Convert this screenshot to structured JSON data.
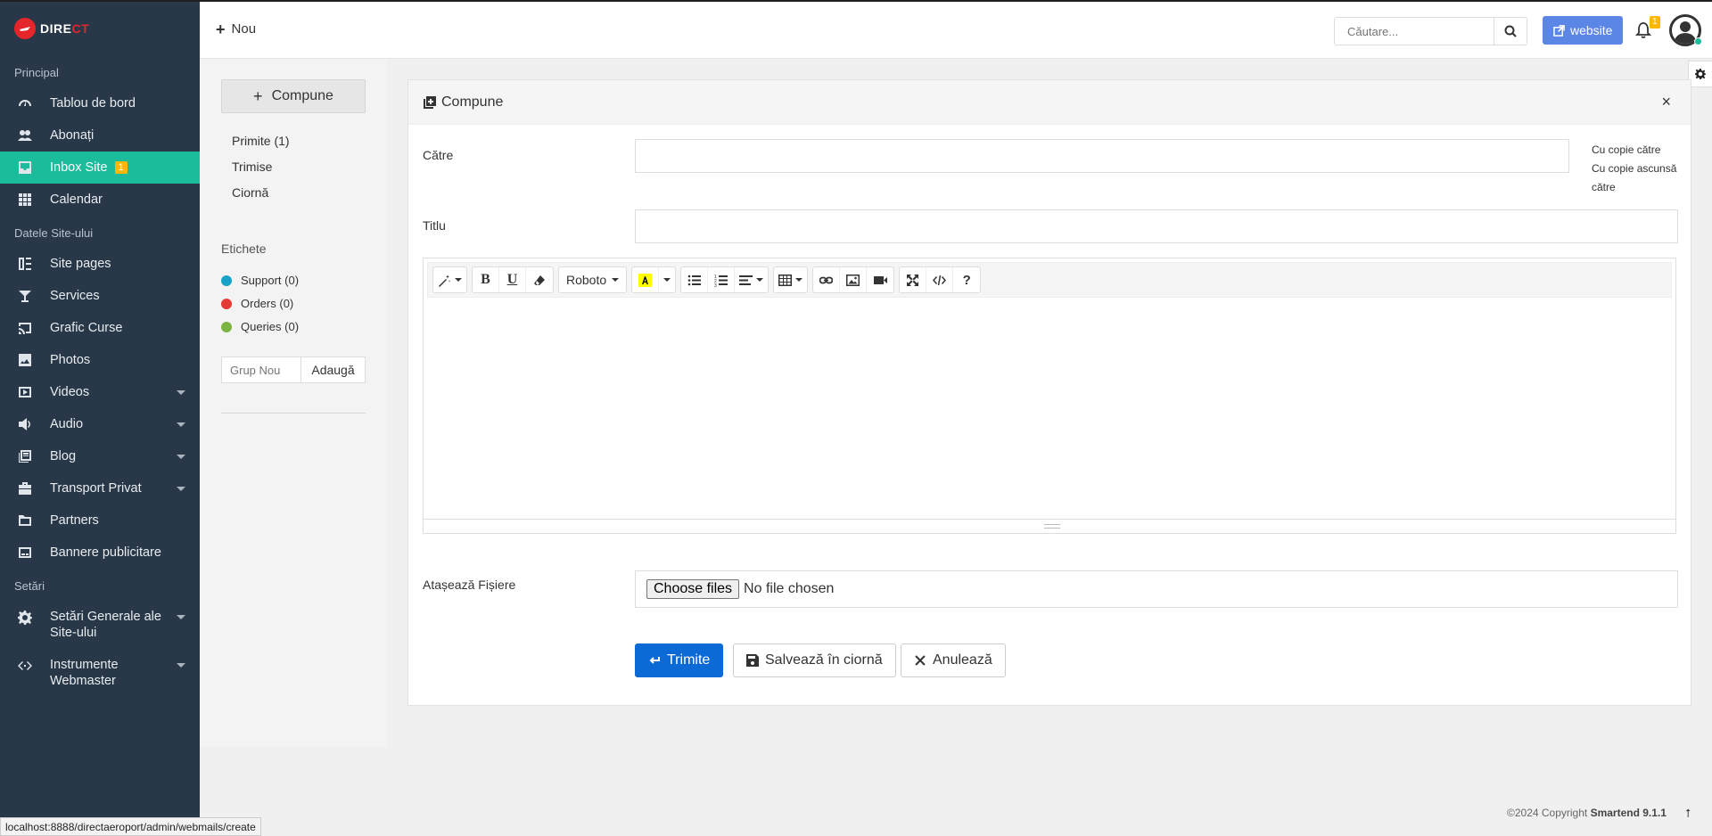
{
  "brand": {
    "logo_text_white": "DIRE",
    "logo_text_red": "CT"
  },
  "sidebar": {
    "sections": {
      "main": "Principal",
      "site_data": "Datele Site-ului",
      "settings": "Setări"
    },
    "items": [
      {
        "label": "Tablou de bord",
        "icon": "dashboard-icon"
      },
      {
        "label": "Abonați",
        "icon": "users-icon"
      },
      {
        "label": "Inbox Site",
        "icon": "inbox-icon",
        "badge": "1",
        "active": true
      },
      {
        "label": "Calendar",
        "icon": "calendar-grid-icon"
      },
      {
        "label": "Site pages",
        "icon": "pages-icon"
      },
      {
        "label": "Services",
        "icon": "services-icon"
      },
      {
        "label": "Grafic Curse",
        "icon": "cast-icon"
      },
      {
        "label": "Photos",
        "icon": "photo-icon"
      },
      {
        "label": "Videos",
        "icon": "video-icon",
        "caret": true
      },
      {
        "label": "Audio",
        "icon": "audio-icon",
        "caret": true
      },
      {
        "label": "Blog",
        "icon": "blog-icon",
        "caret": true
      },
      {
        "label": "Transport Privat",
        "icon": "transport-icon",
        "caret": true
      },
      {
        "label": "Partners",
        "icon": "folder-icon"
      },
      {
        "label": "Bannere publicitare",
        "icon": "banner-icon"
      },
      {
        "label": "Setări Generale ale Site-ului",
        "icon": "gear-icon",
        "caret": true
      },
      {
        "label": "Instrumente Webmaster",
        "icon": "code-icon",
        "caret": true
      }
    ]
  },
  "header": {
    "new_label": "Nou",
    "search_placeholder": "Căutare...",
    "website_label": "website",
    "notifications_badge": "1"
  },
  "mail": {
    "compose_label": "Compune",
    "folders": [
      "Primite (1)",
      "Trimise",
      "Ciornă"
    ],
    "labels_title": "Etichete",
    "labels": [
      {
        "name": "Support",
        "count": "(0)",
        "color": "#17a2c8"
      },
      {
        "name": "Orders",
        "count": "(0)",
        "color": "#e53935"
      },
      {
        "name": "Queries",
        "count": "(0)",
        "color": "#7cb342"
      }
    ],
    "group_placeholder": "Grup Nou",
    "add_label": "Adaugă"
  },
  "compose": {
    "title": "Compune",
    "close": "×",
    "to_label": "Către",
    "cc_label": "Cu copie către",
    "bcc_label": "Cu copie ascunsă către",
    "subject_label": "Titlu",
    "font_name": "Roboto",
    "attach_label": "Atașează Fișiere",
    "choose_files": "Choose files",
    "no_file": "No file chosen",
    "send_label": "Trimite",
    "draft_label": "Salvează în ciornă",
    "cancel_label": "Anulează"
  },
  "footer": {
    "copyright": "©2024 Copyright",
    "product": "Smartend 9.1.1",
    "up": "⭡"
  },
  "status_url": "localhost:8888/directaeroport/admin/webmails/create",
  "colors": {
    "sidebar": "#283848",
    "accent": "#1bbc9b",
    "primary": "#0b6ad6",
    "badge": "#ffb800",
    "website": "#5b86e5"
  }
}
